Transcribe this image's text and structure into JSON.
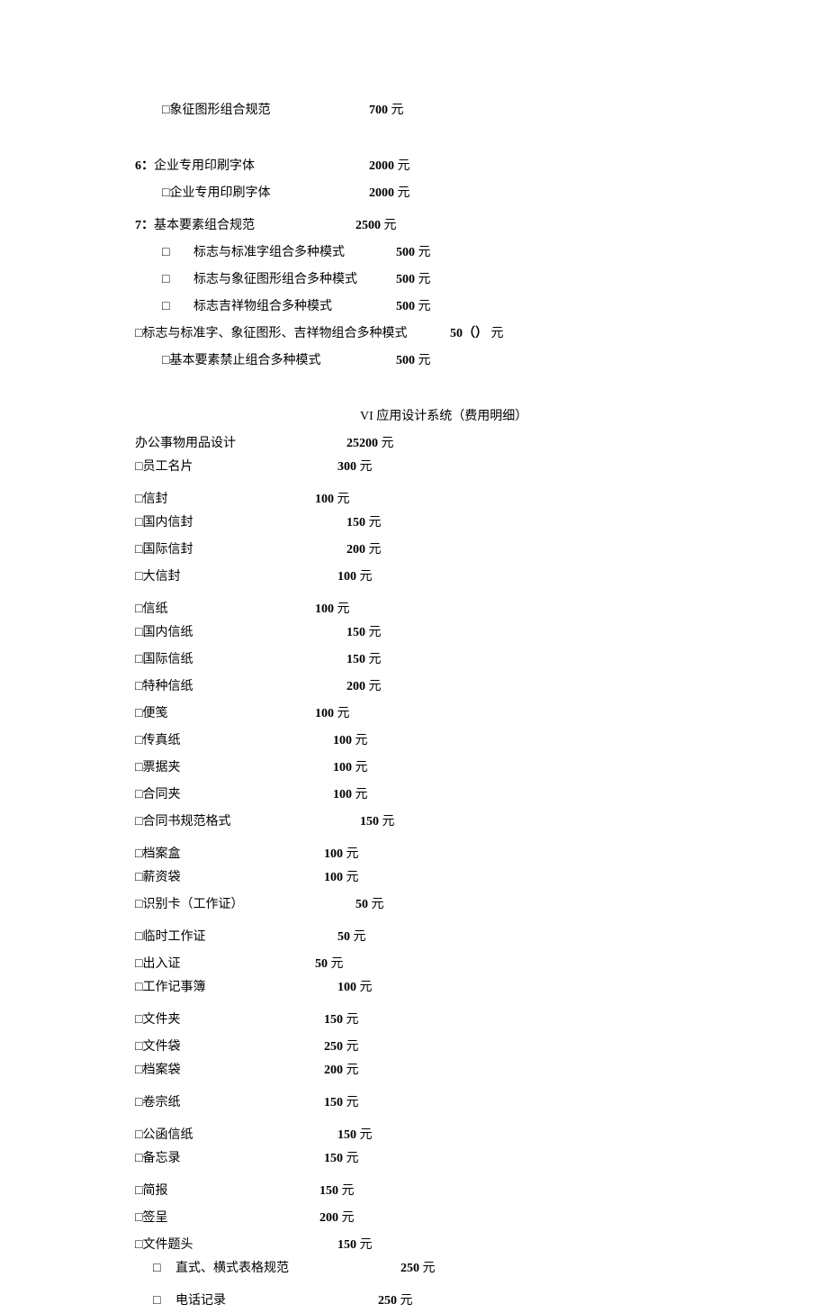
{
  "yuan": "元",
  "top": {
    "row1": {
      "label": "□象征图形组合规范",
      "price": "700"
    }
  },
  "sec6": {
    "header": {
      "prefix": "6：",
      "label": "企业专用印刷字体",
      "price": "2000"
    },
    "row1": {
      "label": "□企业专用印刷字体",
      "price": "2000"
    }
  },
  "sec7": {
    "header": {
      "prefix": "7：",
      "label": "基本要素组合规范",
      "price": "2500"
    },
    "r1": {
      "cb": "□",
      "label": "标志与标准字组合多种模式",
      "price": "500"
    },
    "r2": {
      "cb": "□",
      "label": "标志与象征图形组合多种模式",
      "price": "500"
    },
    "r3": {
      "cb": "□",
      "label": "标志吉祥物组合多种模式",
      "price": "500"
    },
    "r4": {
      "label": "□标志与标准字、象征图形、吉祥物组合多种模式",
      "price": "50（）"
    },
    "r5": {
      "label": "□基本要素禁止组合多种模式",
      "price": "500"
    }
  },
  "appTitle": "VI 应用设计系统（费用明细）",
  "office": {
    "header": {
      "label": "办公事物用品设计",
      "price": "25200"
    },
    "items": [
      {
        "label": "□员工名片",
        "price": "300",
        "pcol": "p-225"
      },
      {
        "label": "□信封",
        "price": "100",
        "pcol": "p-200",
        "gap": "gap-m"
      },
      {
        "label": "□国内信封",
        "price": "150",
        "pcol": "p-235"
      },
      {
        "label": "□国际信封",
        "price": "200",
        "pcol": "p-235",
        "gap": "gap-s"
      },
      {
        "label": "□大信封",
        "price": "100",
        "pcol": "p-225",
        "gap": "gap-s"
      },
      {
        "label": "□信纸",
        "price": "100",
        "pcol": "p-200",
        "gap": "gap-m"
      },
      {
        "label": "□国内信纸",
        "price": "150",
        "pcol": "p-235"
      },
      {
        "label": "□国际信纸",
        "price": "150",
        "pcol": "p-235",
        "gap": "gap-s"
      },
      {
        "label": "□特种信纸",
        "price": "200",
        "pcol": "p-235",
        "gap": "gap-s"
      },
      {
        "label": "□便笺",
        "price": "100",
        "pcol": "p-200",
        "gap": "gap-s"
      },
      {
        "label": "□传真纸",
        "price": "100",
        "pcol": "p-220",
        "gap": "gap-s"
      },
      {
        "label": "□票据夹",
        "price": "100",
        "pcol": "p-220",
        "gap": "gap-s"
      },
      {
        "label": "□合同夹",
        "price": "100",
        "pcol": "p-220",
        "gap": "gap-s"
      },
      {
        "label": "□合同书规范格式",
        "price": "150",
        "pcol": "p-250",
        "gap": "gap-s"
      },
      {
        "label": "□档案盒",
        "price": "100",
        "pcol": "p-210",
        "gap": "gap-m"
      },
      {
        "label": "□薪资袋",
        "price": "100",
        "pcol": "p-210"
      },
      {
        "label": "□识别卡（工作证）",
        "price": "50",
        "pcol": "p-245",
        "gap": "gap-s"
      },
      {
        "label": "□临时工作证",
        "price": "50",
        "pcol": "p-225",
        "gap": "gap-m"
      },
      {
        "label": "□出入证",
        "price": "50",
        "pcol": "p-200",
        "gap": "gap-s"
      },
      {
        "label": "□工作记事簿",
        "price": "100",
        "pcol": "p-225"
      },
      {
        "label": "□文件夹",
        "price": "150",
        "pcol": "p-210",
        "gap": "gap-m"
      },
      {
        "label": "□文件袋",
        "price": "250",
        "pcol": "p-210",
        "gap": "gap-s"
      },
      {
        "label": "□档案袋",
        "price": "200",
        "pcol": "p-210"
      },
      {
        "label": "□卷宗纸",
        "price": "150",
        "pcol": "p-210",
        "gap": "gap-m"
      },
      {
        "label": "□公函信纸",
        "price": "150",
        "pcol": "p-225",
        "gap": "gap-m"
      },
      {
        "label": "□备忘录",
        "price": "150",
        "pcol": "p-210"
      },
      {
        "label": "□简报",
        "price": "150",
        "pcol": "p-205",
        "gap": "gap-m"
      },
      {
        "label": "□签呈",
        "price": "200",
        "pcol": "p-205",
        "gap": "gap-s"
      },
      {
        "label": "□文件题头",
        "price": "150",
        "pcol": "p-225",
        "gap": "gap-s"
      }
    ],
    "tail": [
      {
        "cb": "□",
        "label": "直式、横式表格规范",
        "price": "250",
        "pcol": "p-295"
      },
      {
        "cb": "□",
        "label": "电话记录",
        "price": "250",
        "pcol": "p-270",
        "gap": "gap-m"
      }
    ]
  }
}
